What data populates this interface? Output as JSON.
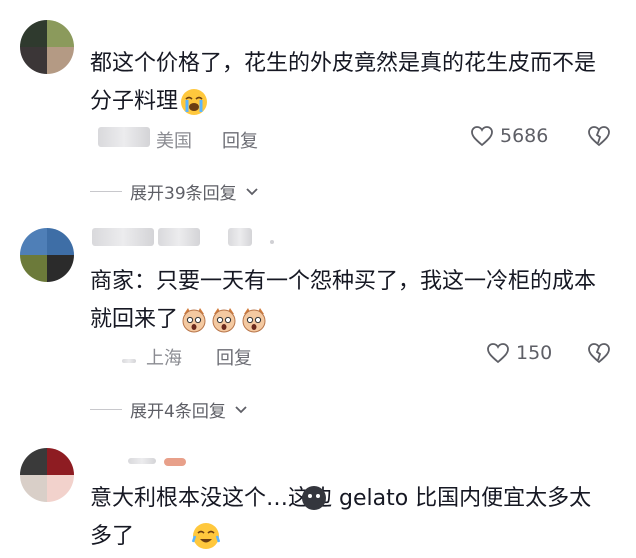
{
  "comments": [
    {
      "text": "都这个价格了，花生的外皮竟然是真的花生皮而不是分子料理",
      "location": "美国",
      "reply_label": "回复",
      "likes": "5686",
      "expand_label": "展开39条回复"
    },
    {
      "text": "商家：只要一天有一个怨种买了，我这一冷柜的成本就回来了",
      "location": "上海",
      "reply_label": "回复",
      "likes": "150",
      "expand_label": "展开4条回复"
    },
    {
      "text": "意大利根本没这个…这边 gelato 比国内便宜太多太多了",
      "location": "",
      "reply_label": "",
      "likes": ""
    }
  ],
  "icons": [
    "heart-outline-icon",
    "broken-heart-icon",
    "chevron-down-icon",
    "crying-face-emoji",
    "dog-face-emoji",
    "dark-blob-emoji",
    "tearful-laugh-emoji"
  ],
  "colors": {
    "text": "#161823",
    "meta": "#8a8b91",
    "icon": "#5e5f66"
  }
}
